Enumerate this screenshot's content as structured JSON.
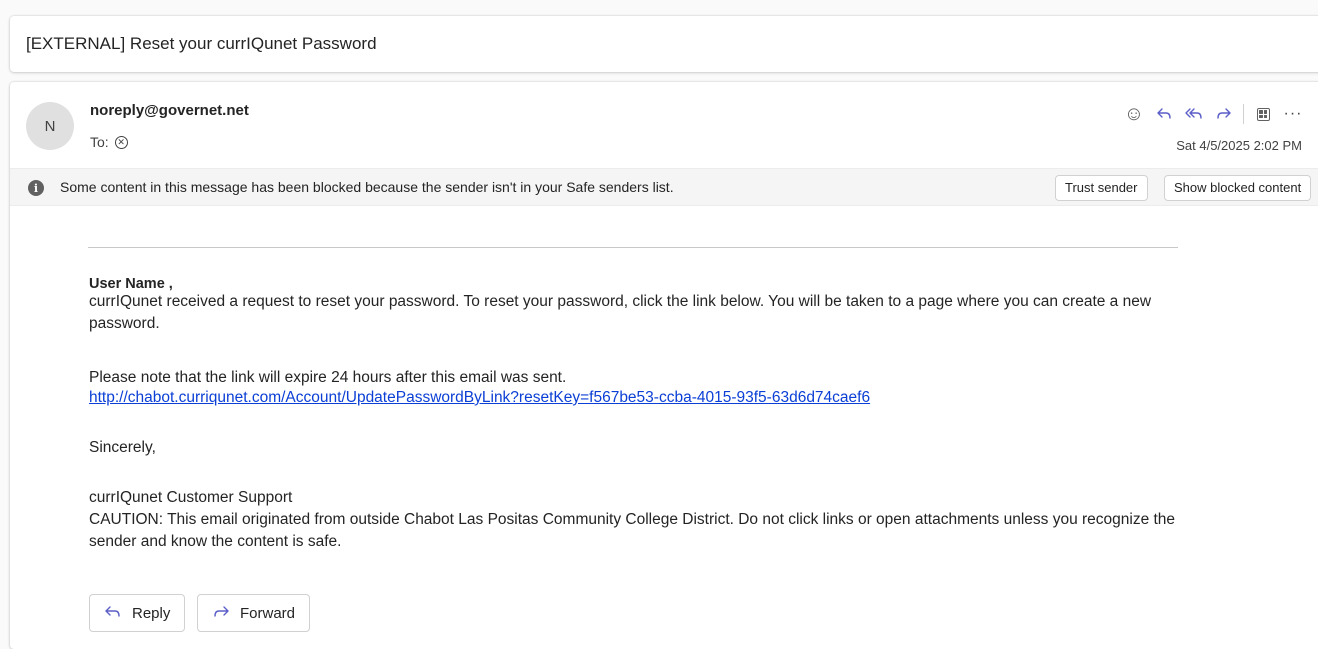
{
  "subject": "[EXTERNAL] Reset your currIQunet Password",
  "message": {
    "avatar_initial": "N",
    "sender": "noreply@governet.net",
    "to_label": "To:",
    "date": "Sat 4/5/2025 2:02 PM",
    "actions": [
      {
        "icon": "emoji-icon"
      },
      {
        "icon": "reply-icon"
      },
      {
        "icon": "reply-all-icon"
      },
      {
        "icon": "forward-icon"
      },
      {
        "icon": "apps-icon"
      },
      {
        "icon": "more-icon",
        "glyph": "···"
      }
    ]
  },
  "banner": {
    "text": "Some content in this message has been blocked because the sender isn't in your Safe senders list.",
    "trust_label": "Trust sender",
    "show_label": "Show blocked content"
  },
  "body": {
    "greeting": "User Name ,",
    "para1": "currIQunet received a request to reset your password. To reset your password, click the link below. You will be taken to a page where you can create a new password.",
    "para2": "Please note that the link will expire 24 hours after this email was sent.",
    "link": "http://chabot.curriqunet.com/Account/UpdatePasswordByLink?resetKey=f567be53-ccba-4015-93f5-63d6d74caef6",
    "sign1": "Sincerely,",
    "sign2": "currIQunet Customer Support",
    "caution": "CAUTION: This email originated from outside Chabot Las Positas Community College District. Do not click links or open attachments unless you recognize the sender and know the content is safe."
  },
  "footer": {
    "reply_label": "Reply",
    "forward_label": "Forward"
  },
  "colors": {
    "accent": "#5b5fc7",
    "link": "#0b3fd6"
  }
}
